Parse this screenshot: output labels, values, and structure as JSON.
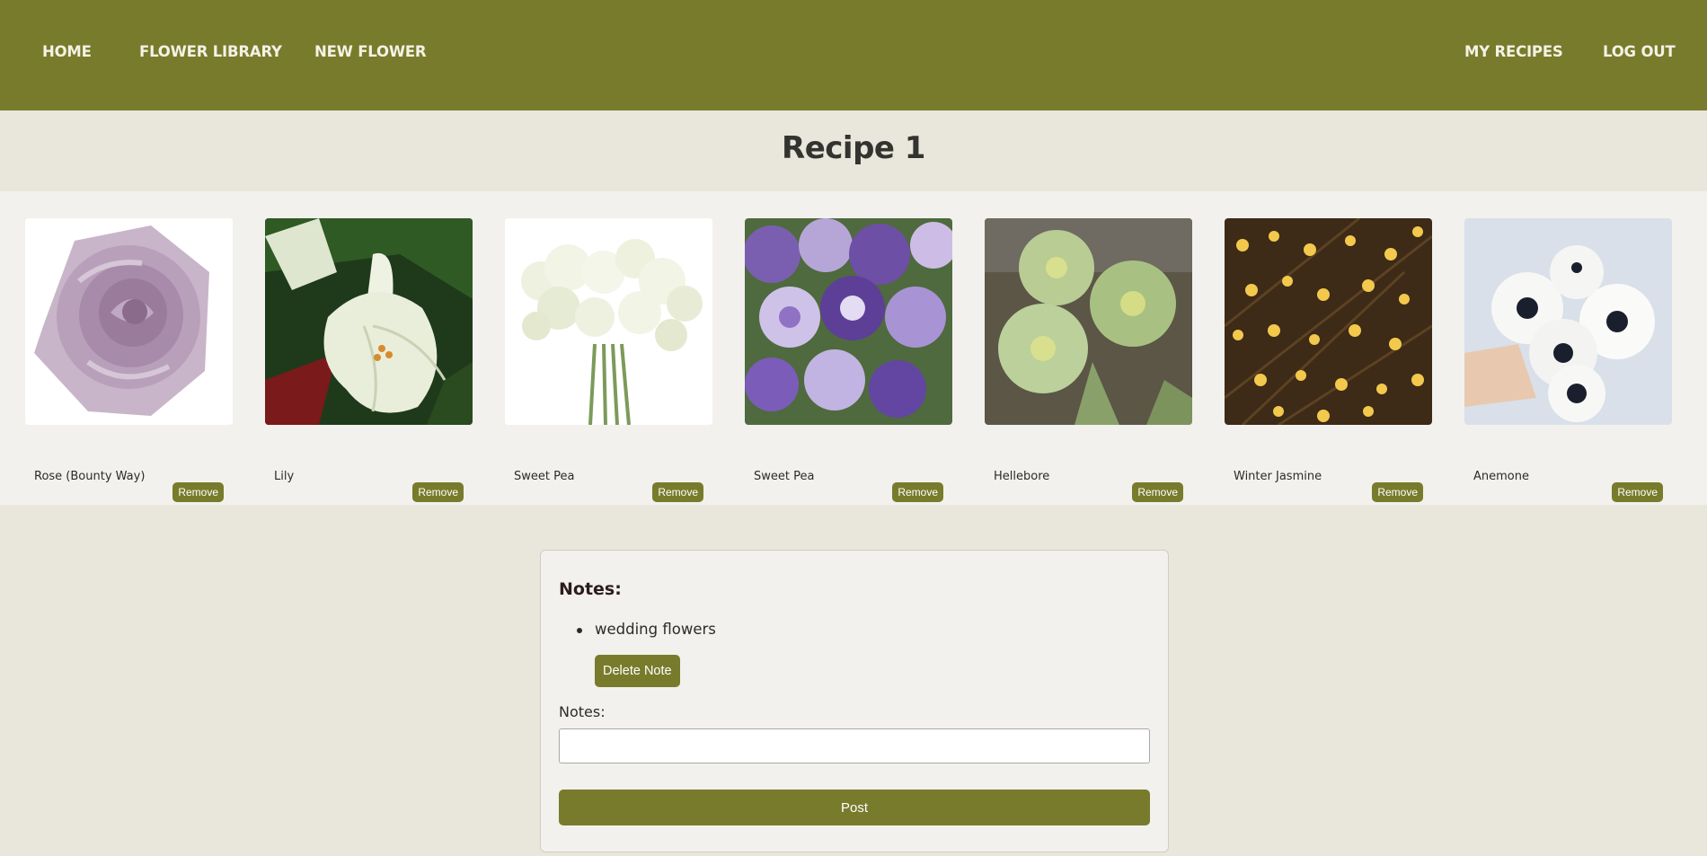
{
  "nav": {
    "home": "HOME",
    "library": "FLOWER LIBRARY",
    "new_flower": "NEW FLOWER",
    "my_recipes": "MY RECIPES",
    "logout": "LOG OUT"
  },
  "page_title": "Recipe 1",
  "flowers": [
    {
      "name": "Rose (Bounty Way)",
      "remove": "Remove"
    },
    {
      "name": "Lily",
      "remove": "Remove"
    },
    {
      "name": "Sweet Pea",
      "remove": "Remove"
    },
    {
      "name": "Sweet Pea",
      "remove": "Remove"
    },
    {
      "name": "Hellebore",
      "remove": "Remove"
    },
    {
      "name": "Winter Jasmine",
      "remove": "Remove"
    },
    {
      "name": "Anemone",
      "remove": "Remove"
    }
  ],
  "notes": {
    "heading": "Notes:",
    "items": [
      "wedding flowers"
    ],
    "delete_label": "Delete Note",
    "input_label": "Notes:",
    "input_value": "",
    "post_label": "Post"
  },
  "colors": {
    "accent": "#787b2b",
    "page_bg": "#e9e7dc",
    "panel_bg": "#f2f1ed"
  }
}
